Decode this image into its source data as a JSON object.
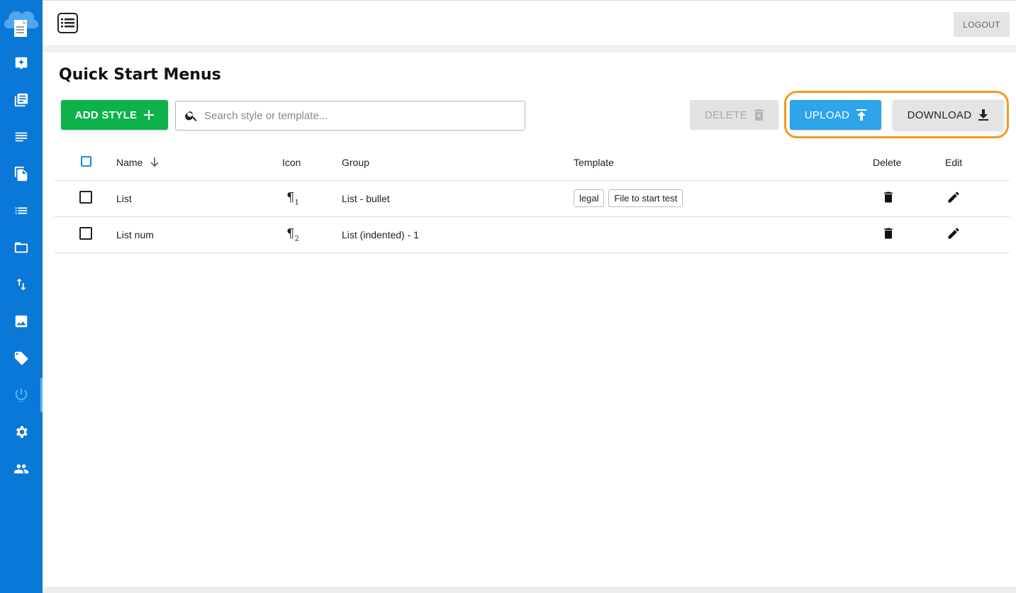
{
  "topbar": {
    "logout_label": "LOGOUT"
  },
  "sidebar": {
    "items": [
      {
        "icon": "magic-icon"
      },
      {
        "icon": "book-icon"
      },
      {
        "icon": "text-lines-icon"
      },
      {
        "icon": "documents-icon"
      },
      {
        "icon": "list-icon"
      },
      {
        "icon": "folder-icon"
      },
      {
        "icon": "sort-arrows-icon"
      },
      {
        "icon": "image-icon"
      },
      {
        "icon": "tag-icon"
      },
      {
        "icon": "power-icon",
        "active": true
      },
      {
        "icon": "gear-icon"
      },
      {
        "icon": "people-icon"
      }
    ]
  },
  "page": {
    "title": "Quick Start Menus"
  },
  "toolbar": {
    "add_label": "ADD STYLE",
    "search_placeholder": "Search style or template...",
    "delete_label": "DELETE",
    "upload_label": "UPLOAD",
    "download_label": "DOWNLOAD"
  },
  "table": {
    "headers": {
      "name": "Name",
      "icon": "Icon",
      "group": "Group",
      "template": "Template",
      "delete": "Delete",
      "edit": "Edit"
    },
    "rows": [
      {
        "name": "List",
        "icon_symbol": "¶",
        "icon_sub": "1",
        "group": "List - bullet",
        "templates": [
          "legal",
          "File to start test"
        ]
      },
      {
        "name": "List num",
        "icon_symbol": "¶",
        "icon_sub": "2",
        "group": "List (indented) - 1",
        "templates": []
      }
    ]
  },
  "colors": {
    "sidebar": "#0a78d6",
    "add": "#0db24a",
    "upload": "#2ea4ea",
    "highlight": "#f29b1c"
  }
}
